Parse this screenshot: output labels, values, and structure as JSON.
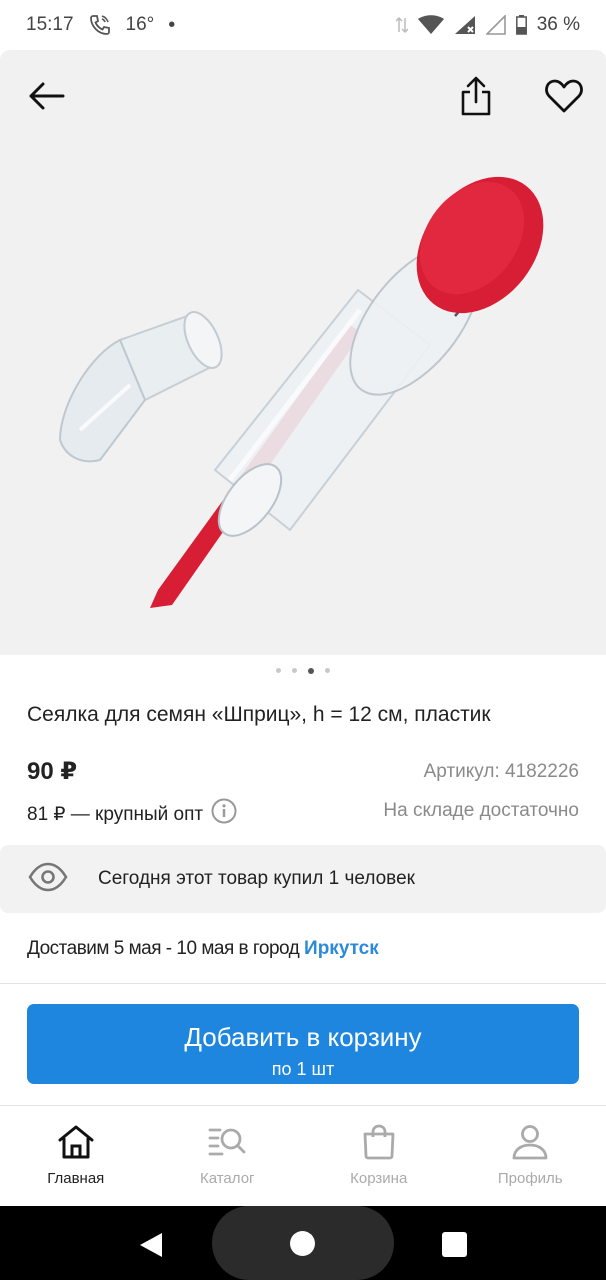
{
  "status": {
    "time": "15:17",
    "temperature": "16°",
    "battery": "36 %"
  },
  "colors": {
    "accent": "#1f86df",
    "link": "#2d8ad8",
    "gallery_bg": "#f1f1f1",
    "product_red": "#d81e35"
  },
  "gallery": {
    "dots_count": 4,
    "active_dot": 2
  },
  "product": {
    "title": "Сеялка для семян «Шприц», h = 12 см, пластик",
    "price": "90 ₽",
    "sku_label": "Артикул:",
    "sku_value": "4182226",
    "wholesale": "81 ₽ — крупный опт",
    "stock": "На складе достаточно"
  },
  "bought": {
    "text": "Сегодня этот товар купил 1 человек"
  },
  "delivery": {
    "text": "Доставим 5 мая - 10 мая в город",
    "city": "Иркутск"
  },
  "cart_button": {
    "label": "Добавить в корзину",
    "sub": "по 1 шт"
  },
  "tabs": [
    {
      "label": "Главная",
      "icon": "home-icon",
      "active": true
    },
    {
      "label": "Каталог",
      "icon": "catalog-search-icon",
      "active": false
    },
    {
      "label": "Корзина",
      "icon": "basket-icon",
      "active": false
    },
    {
      "label": "Профиль",
      "icon": "profile-icon",
      "active": false
    }
  ]
}
